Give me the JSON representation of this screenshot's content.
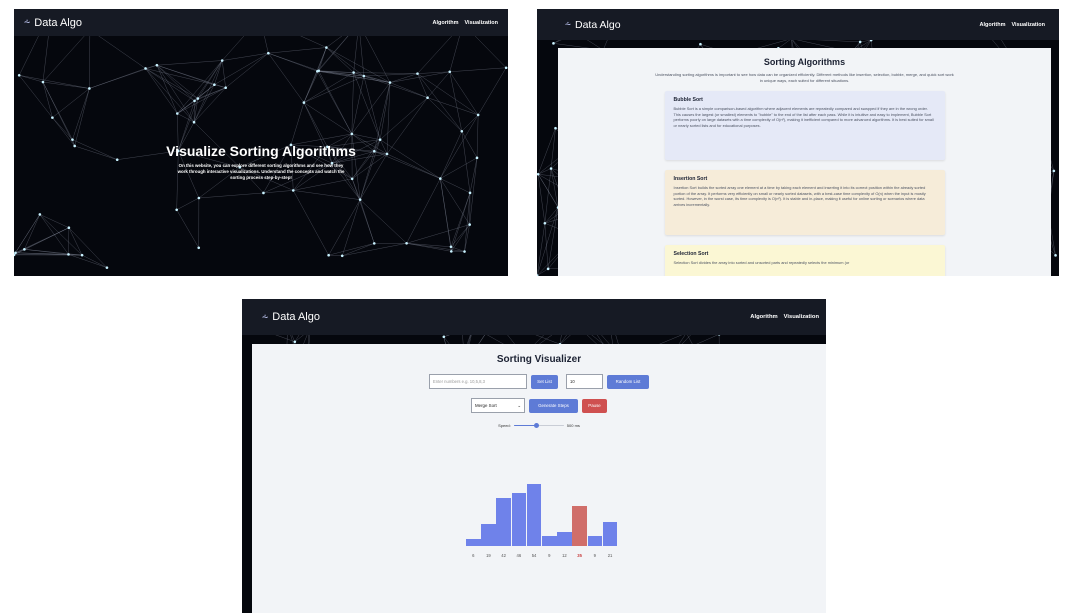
{
  "brand": {
    "logo_icon": "graph-logo-icon",
    "name": "Data Algo"
  },
  "nav": {
    "algorithm": "Algorithm",
    "visualization": "Visualization"
  },
  "home": {
    "title": "Visualize Sorting Algorithms",
    "subtitle": "On this website, you can explore different sorting algorithms and see how they work through interactive visualizations. Understand the concepts and watch the sorting process step-by-step!"
  },
  "algorithms": {
    "title": "Sorting Algorithms",
    "intro": "Understanding sorting algorithms is important to see how data can be organized efficiently. Different methods like insertion, selection, bubble, merge, and quick sort work in unique ways, each suited for different situations.",
    "cards": [
      {
        "name": "Bubble Sort",
        "text": "Bubble Sort is a simple comparison-based algorithm where adjacent elements are repeatedly compared and swapped if they are in the wrong order. This causes the largest (or smallest) elements to \"bubble\" to the end of the list after each pass. While it is intuitive and easy to implement, Bubble Sort performs poorly on large datasets with a time complexity of O(n²), making it inefficient compared to more advanced algorithms. It is best suited for small or nearly sorted lists and for educational purposes.",
        "color": "#e5e9f7"
      },
      {
        "name": "Insertion Sort",
        "text": "Insertion Sort builds the sorted array one element at a time by taking each element and inserting it into its correct position within the already sorted portion of the array. It performs very efficiently on small or nearly sorted datasets, with a best-case time complexity of O(n) when the input is mostly sorted. However, in the worst case, its time complexity is O(n²). It is stable and in-place, making it useful for online sorting or scenarios where data arrives incrementally.",
        "color": "#f6ecd9"
      },
      {
        "name": "Selection Sort",
        "text": "Selection Sort divides the array into sorted and unsorted parts and repeatedly selects the minimum (or",
        "color": "#fbf7d4"
      }
    ]
  },
  "visualizer": {
    "title": "Sorting Visualizer",
    "numbers_placeholder": "Enter numbers e.g. 10,5,8,3",
    "set_list": "Set List",
    "count_value": "10",
    "random_list": "Random List",
    "algorithm_selected": "Merge Sort",
    "generate_steps": "Generate Steps",
    "pause": "Pause",
    "speed_label": "Speed:",
    "speed_value": "500 ms",
    "speed_fraction": 0.45,
    "bar_color": "#6f82ea",
    "highlight_color": "#d06e6a",
    "values": [
      6,
      19,
      42,
      46,
      54,
      9,
      12,
      35,
      9,
      21
    ],
    "value_labels": [
      "6",
      "19",
      "42",
      "46",
      "54",
      "9",
      "12",
      "35",
      "9",
      "21"
    ],
    "highlight_index": 7
  }
}
